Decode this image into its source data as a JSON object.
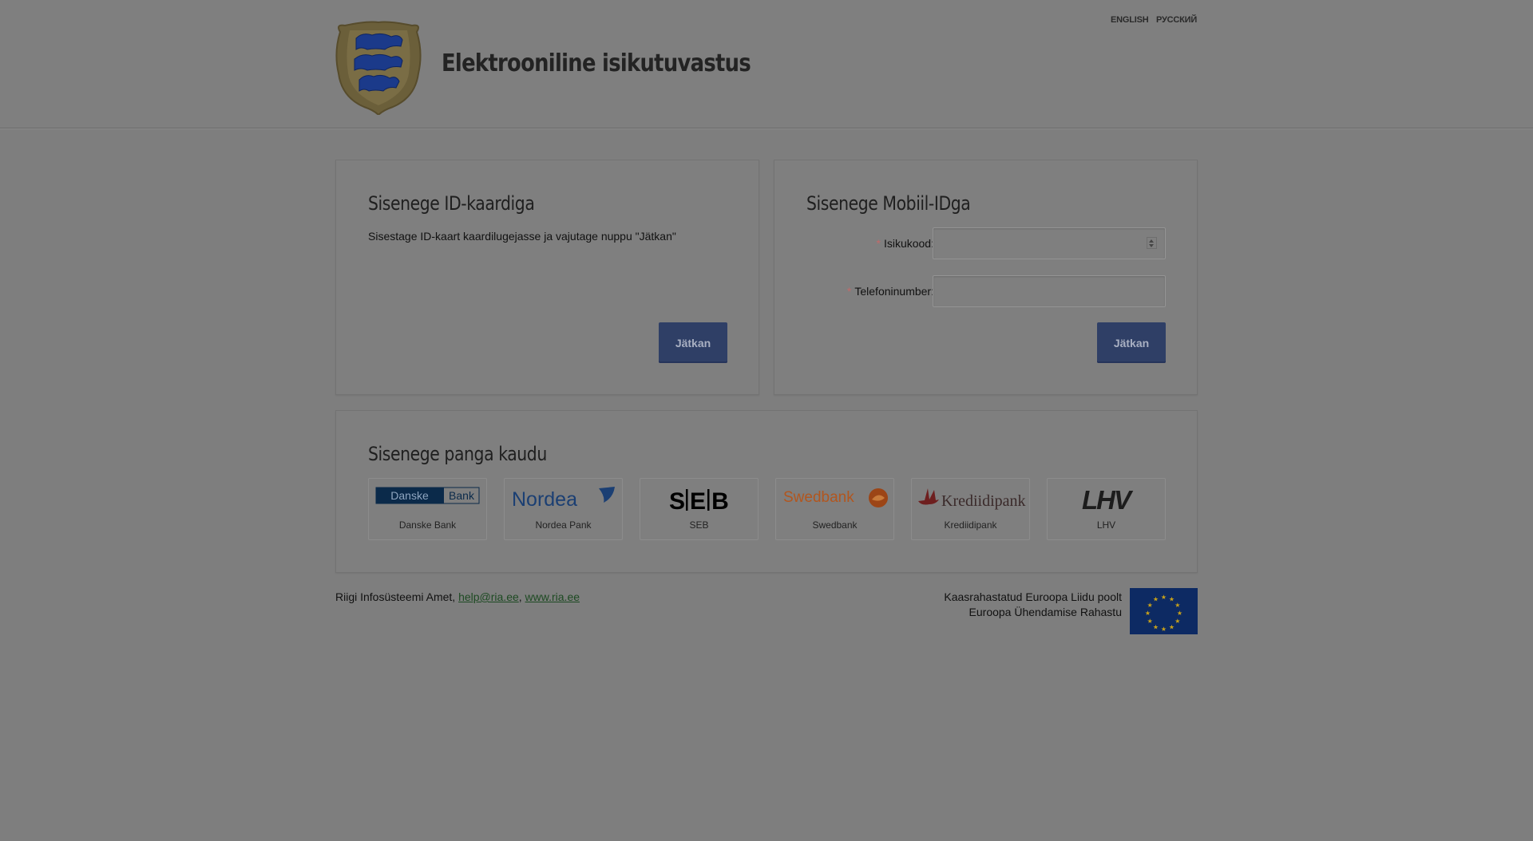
{
  "header": {
    "title": "Elektrooniline isikutuvastus",
    "languages": [
      "ENGLISH",
      "РУССКИЙ"
    ]
  },
  "id_card": {
    "title": "Sisenege ID-kaardiga",
    "instructions": "Sisestage ID-kaart kaardilugejasse ja vajutage nuppu \"Jätkan\"",
    "button": "Jätkan"
  },
  "mobile_id": {
    "title": "Sisenege Mobiil-IDga",
    "fields": [
      {
        "label": "Isikukood:",
        "value": "",
        "required_mark": "*"
      },
      {
        "label": "Telefoninumber:",
        "value": "",
        "required_mark": "*"
      }
    ],
    "button": "Jätkan"
  },
  "bank": {
    "title": "Sisenege panga kaudu",
    "banks": [
      {
        "name": "Danske Bank",
        "logo_text": [
          "Danske",
          "Bank"
        ],
        "logo_color": "#0b2a4a"
      },
      {
        "name": "Nordea Pank",
        "logo_text": [
          "Nordea"
        ],
        "logo_color": "#1b3f73"
      },
      {
        "name": "SEB",
        "logo_text": [
          "S",
          "E",
          "B"
        ],
        "logo_color": "#000000"
      },
      {
        "name": "Swedbank",
        "logo_text": [
          "Swedbank"
        ],
        "logo_color": "#b2561e"
      },
      {
        "name": "Krediidipank",
        "logo_text": [
          "Krediidipank"
        ],
        "logo_color": "#6e1f1f"
      },
      {
        "name": "LHV",
        "logo_text": [
          "LHV"
        ],
        "logo_color": "#1c1c1c"
      }
    ]
  },
  "footer": {
    "org": "Riigi Infosüsteemi Amet,",
    "email": "help@ria.ee",
    "separator": ",",
    "website": "www.ria.ee",
    "eu_line1": "Kaasrahastatud Euroopa Liidu poolt",
    "eu_line2": "Euroopa Ühendamise Rahastu"
  },
  "colors": {
    "button_bg": "#2f3f66",
    "link": "#1d4a22",
    "required": "#c06a6a",
    "eu_flag": "#0d2a63",
    "eu_star": "#c9a21a"
  }
}
